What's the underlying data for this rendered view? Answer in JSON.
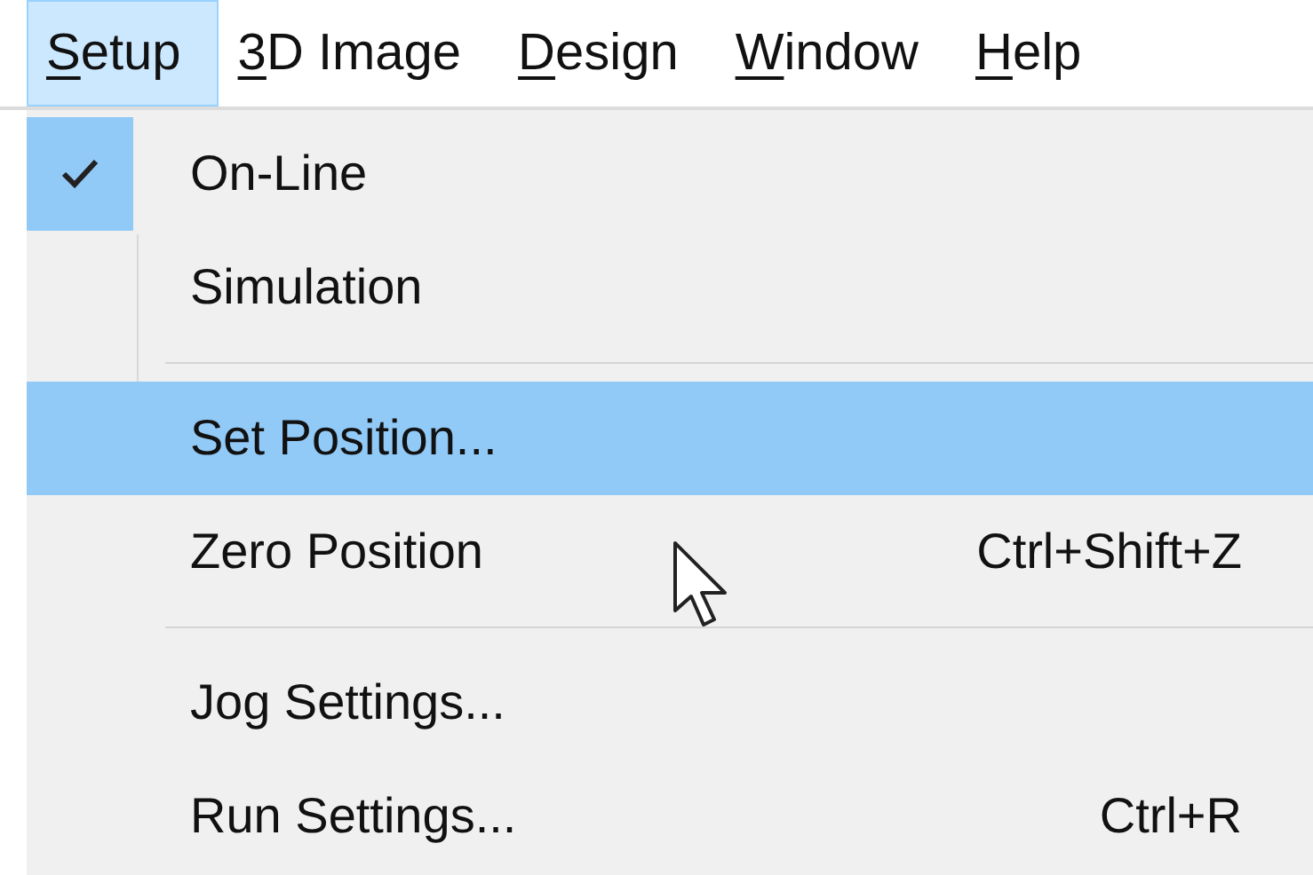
{
  "menu_bar": [
    {
      "label": "Setup",
      "underline_first": true,
      "selected": true
    },
    {
      "label": "3D Image",
      "underline_first": true,
      "selected": false
    },
    {
      "label": "Design",
      "underline_first": true,
      "selected": false
    },
    {
      "label": "Window",
      "underline_first": true,
      "selected": false
    },
    {
      "label": "Help",
      "underline_first": true,
      "selected": false
    }
  ],
  "menu": {
    "items": [
      {
        "kind": "item",
        "label": "On-Line",
        "checked": true,
        "selected": false
      },
      {
        "kind": "item",
        "label": "Simulation",
        "checked": false,
        "selected": false
      },
      {
        "kind": "separator"
      },
      {
        "kind": "item",
        "label": "Set Position...",
        "checked": false,
        "selected": true
      },
      {
        "kind": "item",
        "label": "Zero Position",
        "shortcut": "Ctrl+Shift+Z",
        "checked": false,
        "selected": false
      },
      {
        "kind": "separator"
      },
      {
        "kind": "item",
        "label": "Jog Settings...",
        "checked": false,
        "selected": false
      },
      {
        "kind": "item",
        "label": "Run Settings...",
        "shortcut": "Ctrl+R",
        "checked": false,
        "selected": false
      }
    ]
  }
}
